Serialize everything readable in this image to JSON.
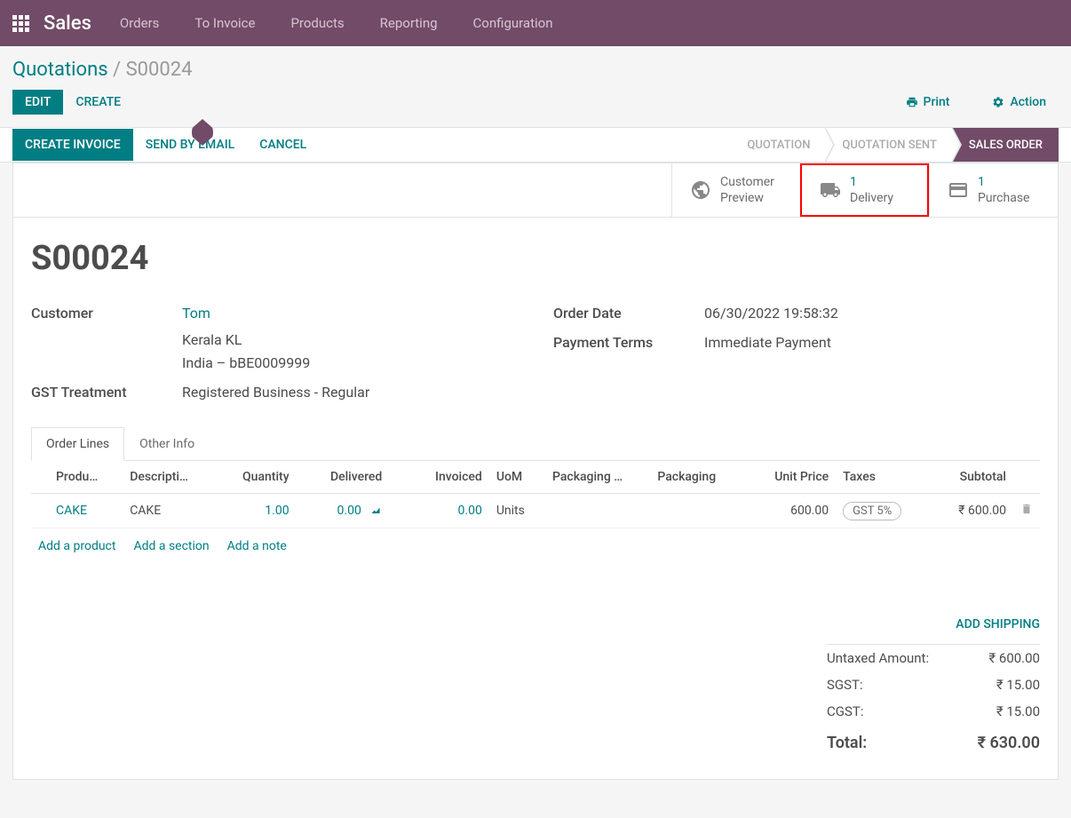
{
  "app_name": "Sales",
  "nav_items": [
    "Orders",
    "To Invoice",
    "Products",
    "Reporting",
    "Configuration"
  ],
  "breadcrumb": {
    "parent": "Quotations",
    "sep": "/",
    "current": "S00024"
  },
  "toolbar": {
    "edit": "EDIT",
    "create": "CREATE",
    "print": "Print",
    "action": "Action"
  },
  "actions": {
    "create_invoice": "CREATE INVOICE",
    "send_email": "SEND BY EMAIL",
    "cancel": "CANCEL"
  },
  "status_steps": {
    "quotation": "QUOTATION",
    "quotation_sent": "QUOTATION SENT",
    "sales_order": "SALES ORDER"
  },
  "stat_buttons": {
    "customer_preview": "Customer\nPreview",
    "delivery": {
      "count": "1",
      "label": "Delivery"
    },
    "purchase": {
      "count": "1",
      "label": "Purchase"
    }
  },
  "record": {
    "title": "S00024",
    "customer_label": "Customer",
    "customer_name": "Tom",
    "customer_region": "Kerala KL",
    "customer_country": "India – bBE0009999",
    "gst_label": "GST Treatment",
    "gst_value": "Registered Business - Regular",
    "order_date_label": "Order Date",
    "order_date_value": "06/30/2022 19:58:32",
    "payment_terms_label": "Payment Terms",
    "payment_terms_value": "Immediate Payment"
  },
  "tabs": {
    "order_lines": "Order Lines",
    "other_info": "Other Info"
  },
  "columns": {
    "product": "Produ…",
    "description": "Descripti…",
    "quantity": "Quantity",
    "delivered": "Delivered",
    "invoiced": "Invoiced",
    "uom": "UoM",
    "packaging_qty": "Packaging …",
    "packaging": "Packaging",
    "unit_price": "Unit Price",
    "taxes": "Taxes",
    "subtotal": "Subtotal"
  },
  "lines": [
    {
      "product": "CAKE",
      "description": "CAKE",
      "quantity": "1.00",
      "delivered": "0.00",
      "invoiced": "0.00",
      "uom": "Units",
      "packaging_qty": "",
      "packaging": "",
      "unit_price": "600.00",
      "taxes": "GST 5%",
      "subtotal": "₹ 600.00"
    }
  ],
  "add_links": {
    "product": "Add a product",
    "section": "Add a section",
    "note": "Add a note"
  },
  "totals": {
    "add_shipping": "ADD SHIPPING",
    "untaxed_label": "Untaxed Amount:",
    "untaxed_value": "₹ 600.00",
    "sgst_label": "SGST:",
    "sgst_value": "₹ 15.00",
    "cgst_label": "CGST:",
    "cgst_value": "₹ 15.00",
    "total_label": "Total:",
    "total_value": "₹ 630.00"
  }
}
